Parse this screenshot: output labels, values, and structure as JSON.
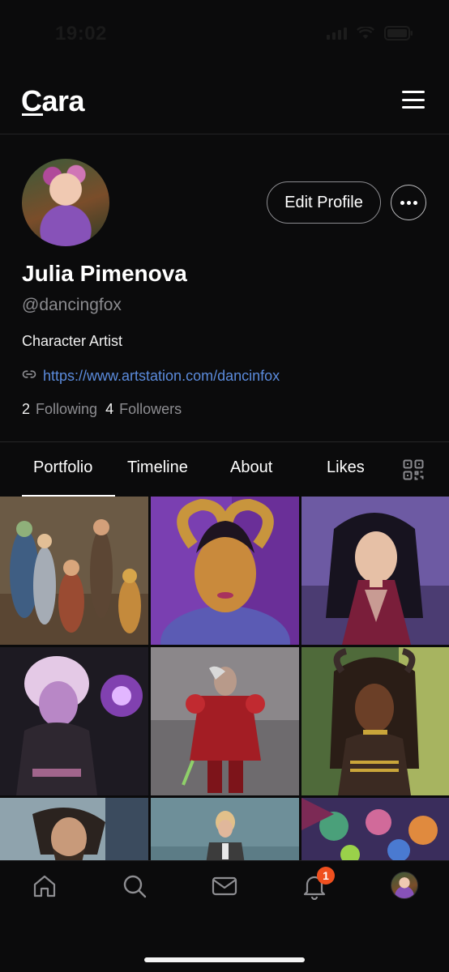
{
  "status_bar": {
    "time": "19:02"
  },
  "header": {
    "logo": "Cara"
  },
  "profile": {
    "edit_label": "Edit Profile",
    "name": "Julia Pimenova",
    "handle": "@dancingfox",
    "bio": "Character Artist",
    "link": "https://www.artstation.com/dancinfox",
    "following_count": "2",
    "following_label": "Following",
    "followers_count": "4",
    "followers_label": "Followers"
  },
  "tabs": [
    {
      "label": "Portfolio",
      "active": true
    },
    {
      "label": "Timeline",
      "active": false
    },
    {
      "label": "About",
      "active": false
    },
    {
      "label": "Likes",
      "active": false
    }
  ],
  "portfolio_tiles": [
    {
      "icon": "artwork-adventurer-party"
    },
    {
      "icon": "artwork-horned-tiefling"
    },
    {
      "icon": "artwork-elf-sorceress"
    },
    {
      "icon": "artwork-lavender-mage"
    },
    {
      "icon": "artwork-red-armor-knight"
    },
    {
      "icon": "artwork-dreadlock-tiefling"
    },
    {
      "icon": "artwork-bearded-ranger"
    },
    {
      "icon": "artwork-blonde-swordswoman"
    },
    {
      "icon": "artwork-monster-group"
    }
  ],
  "bottom_nav": {
    "items": [
      "home-icon",
      "search-icon",
      "mail-icon",
      "bell-icon",
      "profile-avatar"
    ],
    "notification_count": "1"
  },
  "colors": {
    "accent_link": "#5b8bdc",
    "badge": "#f0501f",
    "background": "#0b0b0c"
  }
}
